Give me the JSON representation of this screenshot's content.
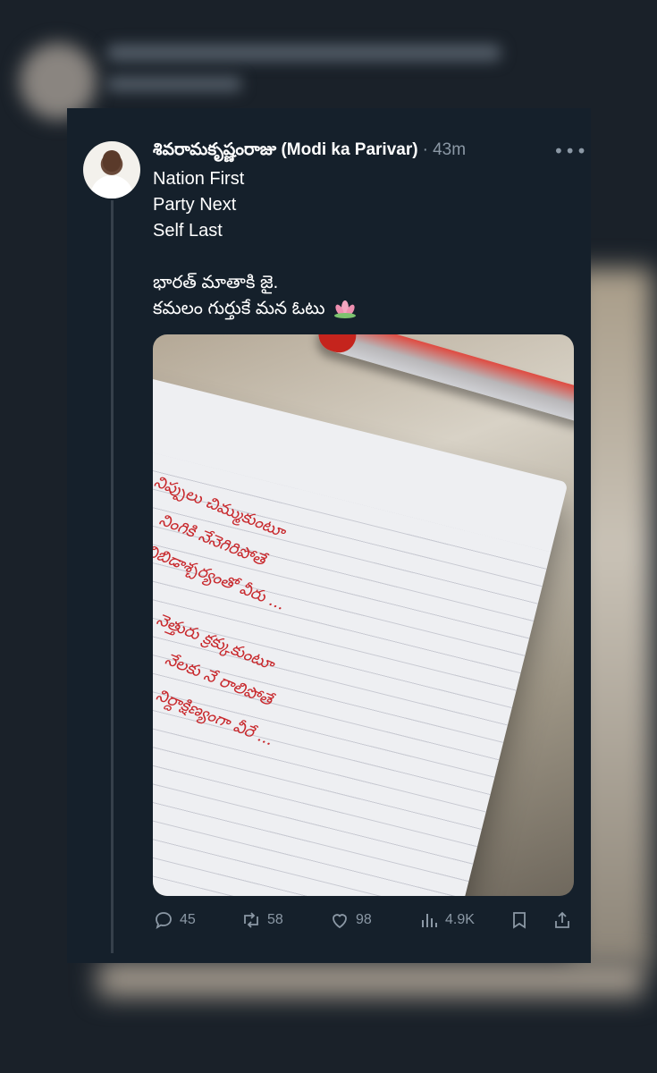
{
  "tweet": {
    "author_name": "శివరామకృష్ణంరాజు (Modi ka Parivar)",
    "separator": "·",
    "time": "43m",
    "more_label": "•••",
    "lines": [
      "Nation First",
      "Party Next",
      "Self Last",
      "",
      "భారత్ మాతాకి జై.",
      "కమలం గుర్తుకే మన ఓటు"
    ],
    "photo_text": [
      "నిప్పులు చిమ్ముకుంటూ",
      "నింగికి నేనెగిరిపోతే",
      "నిబిడాశ్చర్యంతో వీరు ...",
      "నెత్తురు క్రక్కుకుంటూ",
      "నేలకు నే రాలిపోతే",
      "నిర్దాక్షిణ్యంగా వీరే ..."
    ]
  },
  "actions": {
    "replies": "45",
    "retweets": "58",
    "likes": "98",
    "views": "4.9K"
  },
  "colors": {
    "background": "#15202b",
    "muted": "#8b98a5",
    "text": "#ffffff",
    "ink": "#c8282c"
  }
}
